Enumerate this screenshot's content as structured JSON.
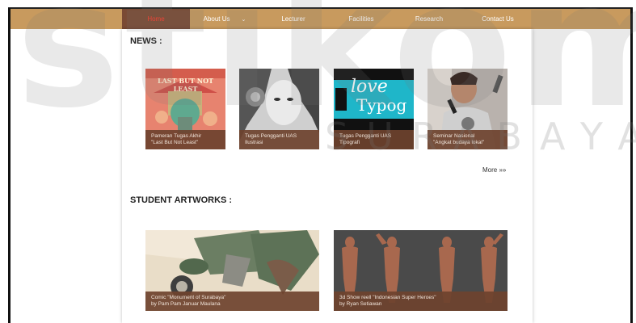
{
  "nav": {
    "items": [
      {
        "label": "Home",
        "active": true
      },
      {
        "label": "About Us",
        "has_dropdown": true
      },
      {
        "label": "Lecturer"
      },
      {
        "label": "Facilities"
      },
      {
        "label": "Research"
      },
      {
        "label": "Contact Us"
      }
    ]
  },
  "watermark": {
    "big": "stikom",
    "small": "SURABAYA"
  },
  "news": {
    "title": "NEWS :",
    "more_label": "More »»",
    "items": [
      {
        "line1": "Pameran Tugas Akhir",
        "line2": "\"Last But Not Least\"",
        "thumb_text": "LAST BUT NOT LEAST"
      },
      {
        "line1": "Tugas Pengganti UAS",
        "line2": "Ilustrasi"
      },
      {
        "line1": "Tugas Pengganti UAS",
        "line2": "Tipografi",
        "thumb_text_a": "love",
        "thumb_text_b": "Typog"
      },
      {
        "line1": "Seminar Nasional",
        "line2": "\"Angkat budaya lokal\""
      }
    ]
  },
  "artworks": {
    "title": "STUDENT ARTWORKS :",
    "items": [
      {
        "line1": "Comic \"Monument of Surabaya\"",
        "line2": "by Pam Pam Januar Maulana"
      },
      {
        "line1": "3d Show reell \"Indonesian Super Heroes\"",
        "line2": "by Ryan Setiawan"
      }
    ]
  },
  "colors": {
    "topbar": "#c89a5e",
    "active_tab": "#7a4a34",
    "active_text": "#ff3b2b",
    "caption_bg": "#6e422e"
  }
}
